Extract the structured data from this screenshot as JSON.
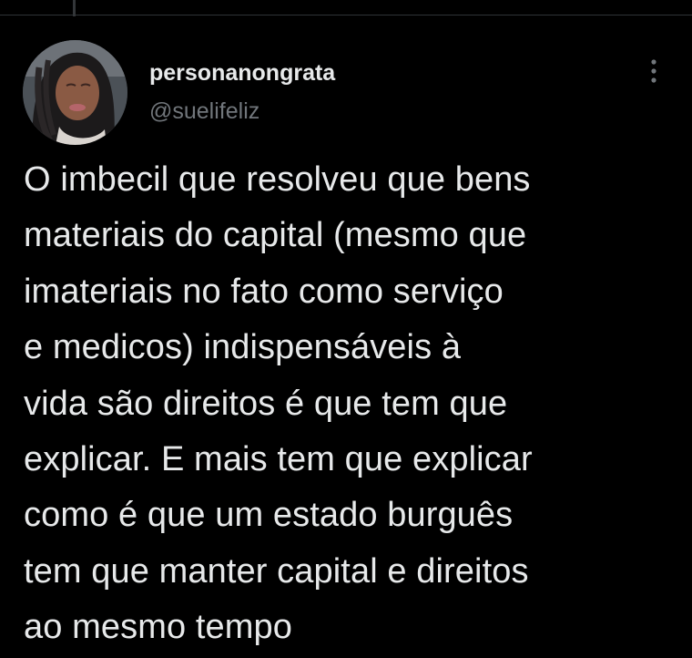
{
  "tweet": {
    "author": {
      "display_name": "personanongrata",
      "handle": "@suelifeliz"
    },
    "text": "O imbecil que resolveu que bens\nmateriais do capital (mesmo que\nimateriais no fato como serviço\ne medicos) indispensáveis à\nvida são direitos é  que tem que\nexplicar. E mais tem que explicar\ncomo é que um estado burguês\ntem que manter capital e direitos\nao mesmo tempo"
  },
  "icons": {
    "more": "more-vertical-icon",
    "avatar": "avatar"
  },
  "colors": {
    "background": "#000000",
    "text_primary": "#e7e9ea",
    "text_secondary": "#71767b",
    "divider": "#2f3336"
  }
}
